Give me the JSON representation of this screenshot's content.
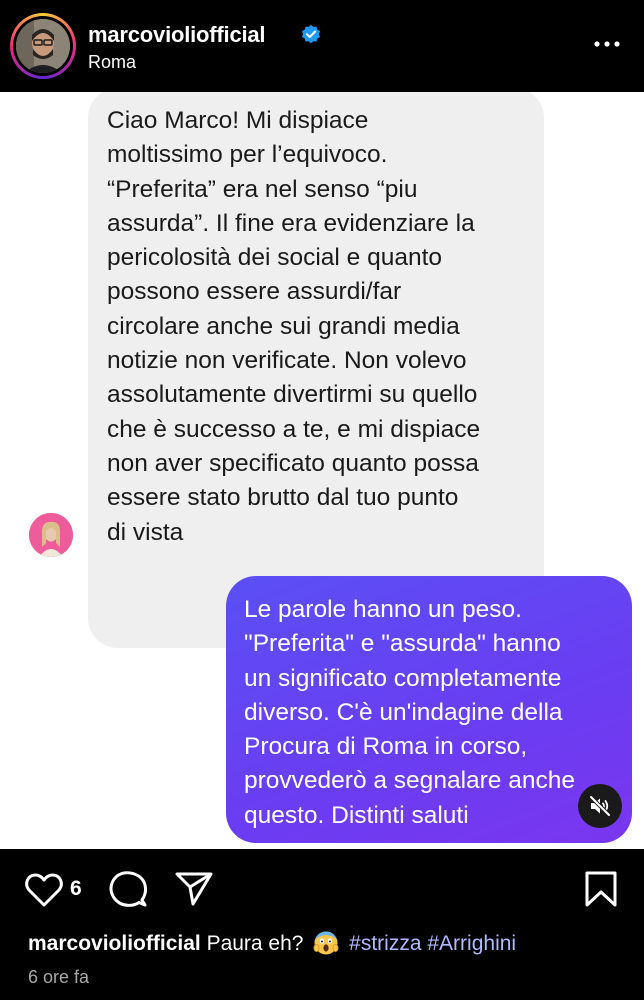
{
  "header": {
    "username": "marcoviolioffical_placeholder",
    "location": "Roma",
    "more_icon": "more-horizontal-icon",
    "verified_icon": "verified-badge-icon"
  },
  "post": {
    "incoming_message": "Ciao Marco! Mi dispiace\nmoltissimo per l’equivoco.\n“Preferita” era nel senso “piu\nassurda”. Il fine era evidenziare la\npericolosità dei social e quanto\npossono essere assurdi/far\ncircolare anche sui grandi media\nnotizie non verificate. Non volevo\nassolutamente divertirmi su quello\nche è successo a te, e mi dispiace\nnon aver specificato quanto possa\nessere stato brutto dal tuo punto\ndi vista",
    "outgoing_message": "Le parole hanno un peso.\n\"Preferita\" e \"assurda\" hanno\nun significato completamente\ndiverso. C'è un'indagine della\nProcura di Roma in corso,\nprovvederò a segnalare anche\nquesto. Distinti saluti",
    "mute_icon": "speaker-muted-icon"
  },
  "actions": {
    "like_icon": "heart-icon",
    "like_count": "6",
    "comment_icon": "comment-bubble-icon",
    "share_icon": "send-paper-plane-icon",
    "save_icon": "bookmark-icon"
  },
  "caption": {
    "username": "marcoviolioffical_placeholder",
    "text": "Paura eh?",
    "emoji": "face-screaming-in-fear-emoji",
    "hashtags": [
      "#strizza",
      "#Arrighini"
    ]
  },
  "timestamp": "6 ore fa"
}
